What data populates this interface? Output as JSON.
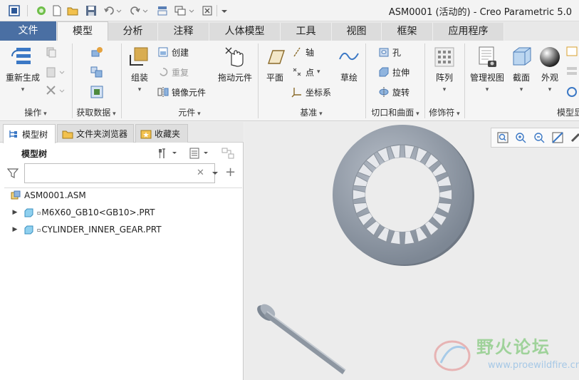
{
  "window": {
    "title": "ASM0001 (活动的) - Creo Parametric 5.0"
  },
  "menu": {
    "tabs": [
      "文件",
      "模型",
      "分析",
      "注释",
      "人体模型",
      "工具",
      "视图",
      "框架",
      "应用程序"
    ],
    "active": "模型"
  },
  "ribbon": {
    "regenerate": "重新生成",
    "groups": {
      "operations": "操作",
      "get_data": "获取数据",
      "component": "元件",
      "datum": "基准",
      "cut_surface": "切口和曲面",
      "modifier": "修饰符",
      "model_display": "模型显"
    },
    "assemble": "组装",
    "create": "创建",
    "repeat": "重复",
    "mirror_component": "镜像元件",
    "drag_component": "拖动元件",
    "plane": "平面",
    "axis": "轴",
    "point": "点",
    "csys": "坐标系",
    "sketch": "草绘",
    "hole": "孔",
    "extrude": "拉伸",
    "revolve": "旋转",
    "pattern": "阵列",
    "manage_views": "管理视图",
    "section": "截面",
    "appearance": "外观"
  },
  "panel": {
    "tabs": [
      "模型树",
      "文件夹浏览器",
      "收藏夹"
    ],
    "tree_title": "模型树",
    "search_value": "",
    "items": [
      {
        "name": "ASM0001.ASM",
        "level": 0
      },
      {
        "name": "M6X60_GB10<GB10>.PRT",
        "level": 1
      },
      {
        "name": "CYLINDER_INNER_GEAR.PRT",
        "level": 1
      }
    ]
  },
  "watermark": {
    "name": "野火论坛",
    "url": "www.proewildfire.cn"
  },
  "colors": {
    "file_tab": "#4a6fa3",
    "part_gray": "#9aa3ad",
    "ribbon_bg": "#f5f5f5"
  },
  "icons": {
    "titlebar": [
      "app-icon",
      "regenerate-icon",
      "new-icon",
      "open-icon",
      "save-icon",
      "undo-icon",
      "redo-icon",
      "window-icon",
      "close-window-icon",
      "customize-icon"
    ],
    "viewport": [
      "refit-icon",
      "zoom-in-icon",
      "zoom-out-icon",
      "repaint-icon",
      "display-style-icon"
    ]
  }
}
